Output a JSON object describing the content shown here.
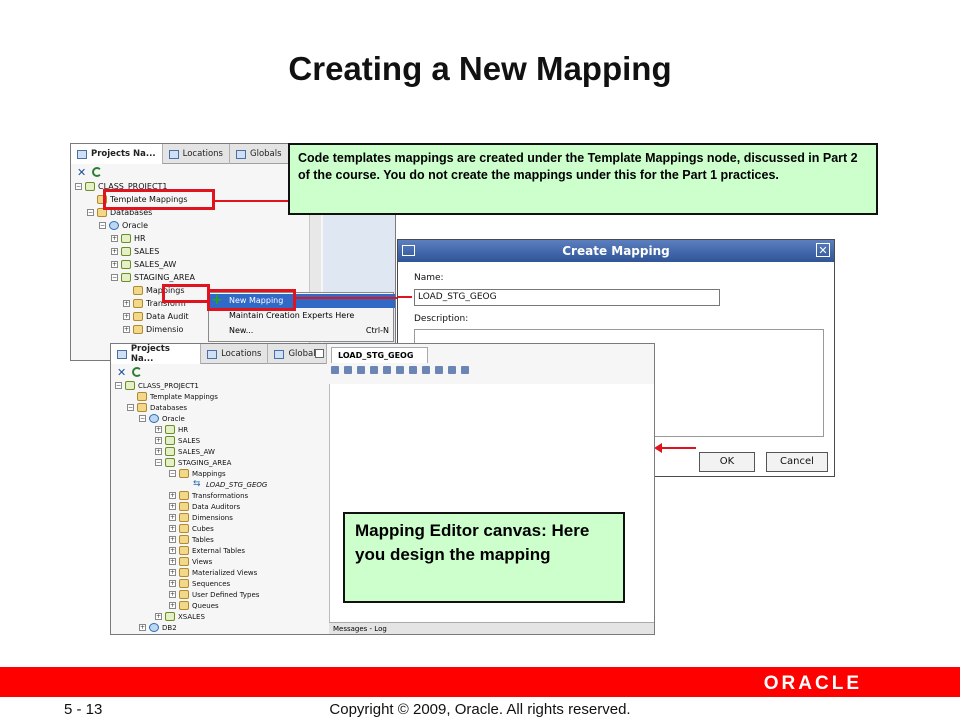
{
  "slide": {
    "title": "Creating a New Mapping",
    "page_number": "5 - 13",
    "copyright": "Copyright © 2009, Oracle. All rights reserved.",
    "logo_text": "ORACLE",
    "brand_color": "#ff0000",
    "callout_color": "#ccffcc"
  },
  "back_window": {
    "tabs": [
      "Projects Na...",
      "Locations",
      "Globals"
    ],
    "tree": [
      "CLASS_PROJECT1",
      "Template Mappings",
      "Databases",
      "Oracle",
      "HR",
      "SALES",
      "SALES_AW",
      "STAGING_AREA",
      "Mappings",
      "Transform",
      "Data Audit",
      "Dimensio"
    ]
  },
  "context_menu": {
    "items": [
      {
        "label": "New Mapping",
        "shortcut": ""
      },
      {
        "label": "Maintain Creation Experts Here",
        "shortcut": ""
      },
      {
        "label": "New...",
        "shortcut": "Ctrl-N"
      }
    ]
  },
  "callout_top": {
    "text": "Code templates mappings are created under the Template Mappings node, discussed in Part 2 of the course. You do not create the mappings under this for the Part 1 practices."
  },
  "dialog": {
    "title": "Create Mapping",
    "name_label": "Name:",
    "name_value": "LOAD_STG_GEOG",
    "description_label": "Description:",
    "ok_label": "OK",
    "cancel_label": "Cancel"
  },
  "front_window": {
    "tabs": [
      "Projects Na...",
      "Locations",
      "Globals"
    ],
    "editor_tab": "LOAD_STG_GEOG",
    "log_tab": "Messages - Log",
    "tree": [
      "CLASS_PROJECT1",
      "Template Mappings",
      "Databases",
      "Oracle",
      "HR",
      "SALES",
      "SALES_AW",
      "STAGING_AREA",
      "Mappings",
      "LOAD_STG_GEOG",
      "Transformations",
      "Data Auditors",
      "Dimensions",
      "Cubes",
      "Tables",
      "External Tables",
      "Views",
      "Materialized Views",
      "Sequences",
      "User Defined Types",
      "Queues",
      "XSALES",
      "DB2"
    ]
  },
  "callout_editor": {
    "text": "Mapping Editor canvas: Here you design the mapping"
  }
}
